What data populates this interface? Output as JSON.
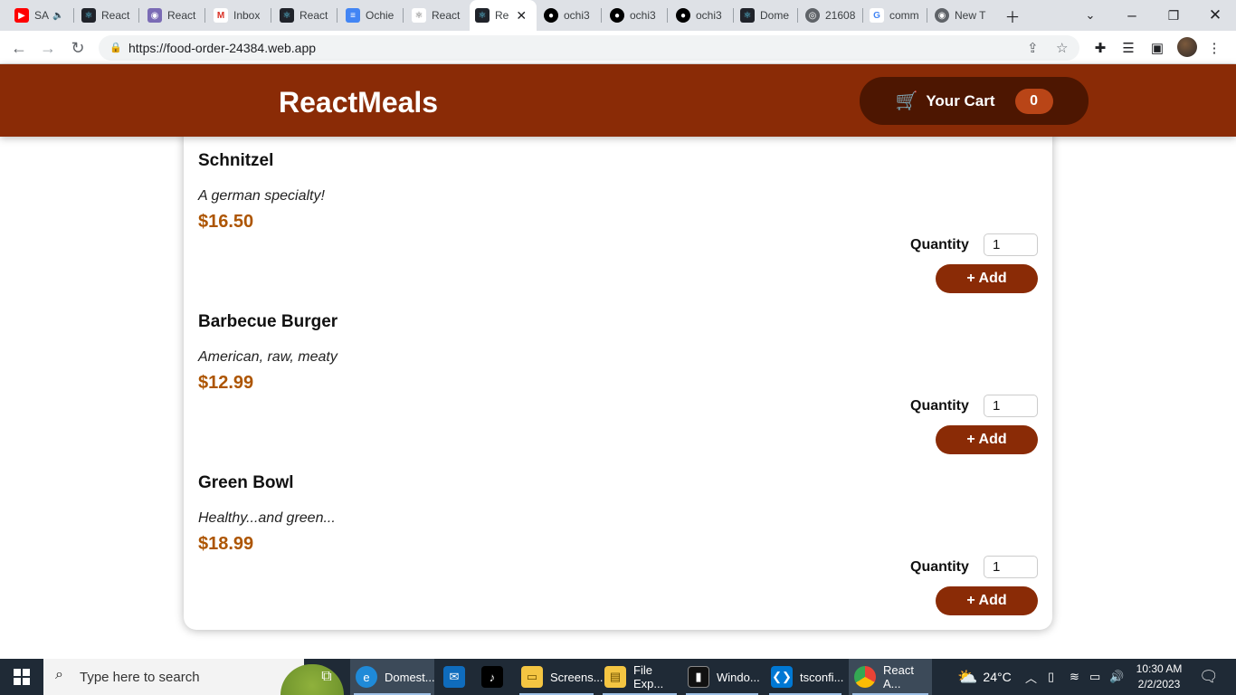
{
  "browser": {
    "tabs": [
      {
        "label": "SA",
        "icon": "youtube-icon",
        "color": "#ff0000"
      },
      {
        "label": "React",
        "icon": "react-icon",
        "color": "#20232a"
      },
      {
        "label": "React",
        "icon": "owl-icon",
        "color": "#7a6bb5"
      },
      {
        "label": "Inbox",
        "icon": "gmail-icon",
        "color": "#ffffff"
      },
      {
        "label": "React",
        "icon": "react-icon",
        "color": "#20232a"
      },
      {
        "label": "Ochie",
        "icon": "docs-icon",
        "color": "#4285f4"
      },
      {
        "label": "React",
        "icon": "react-outline-icon",
        "color": "#ffffff"
      },
      {
        "label": "Re",
        "icon": "react-icon",
        "color": "#20232a"
      },
      {
        "label": "ochi3",
        "icon": "github-icon",
        "color": "#000000"
      },
      {
        "label": "ochi3",
        "icon": "github-icon",
        "color": "#000000"
      },
      {
        "label": "ochi3",
        "icon": "github-icon",
        "color": "#000000"
      },
      {
        "label": "Dome",
        "icon": "react-icon",
        "color": "#20232a"
      },
      {
        "label": "21608",
        "icon": "globe-icon",
        "color": "#5f6368"
      },
      {
        "label": "comm",
        "icon": "google-icon",
        "color": "#ffffff"
      },
      {
        "label": "New T",
        "icon": "chrome-icon",
        "color": "#5f6368"
      }
    ],
    "url": "https://food-order-24384.web.app"
  },
  "app": {
    "title": "ReactMeals",
    "cart_label": "Your Cart",
    "cart_count": "0",
    "quantity_label": "Quantity",
    "add_label": "+ Add",
    "brand_color": "#8a2b06",
    "price_color": "#ad5502"
  },
  "meals": [
    {
      "name": "Schnitzel",
      "description": "A german specialty!",
      "price": "$16.50",
      "quantity": "1"
    },
    {
      "name": "Barbecue Burger",
      "description": "American, raw, meaty",
      "price": "$12.99",
      "quantity": "1"
    },
    {
      "name": "Green Bowl",
      "description": "Healthy...and green...",
      "price": "$18.99",
      "quantity": "1"
    }
  ],
  "taskbar": {
    "search_placeholder": "Type here to search",
    "tasks": [
      {
        "label": "Domest...",
        "icon": "edge-icon"
      },
      {
        "label": "",
        "icon": "mail-icon"
      },
      {
        "label": "",
        "icon": "tiktok-icon"
      },
      {
        "label": "Screens...",
        "icon": "folder-icon"
      },
      {
        "label": "File Exp...",
        "icon": "file-explorer-icon"
      },
      {
        "label": "Windo...",
        "icon": "terminal-icon"
      },
      {
        "label": "tsconfi...",
        "icon": "vscode-icon"
      },
      {
        "label": "React A...",
        "icon": "chrome-icon"
      }
    ],
    "weather": "24°C",
    "time": "10:30 AM",
    "date": "2/2/2023"
  }
}
